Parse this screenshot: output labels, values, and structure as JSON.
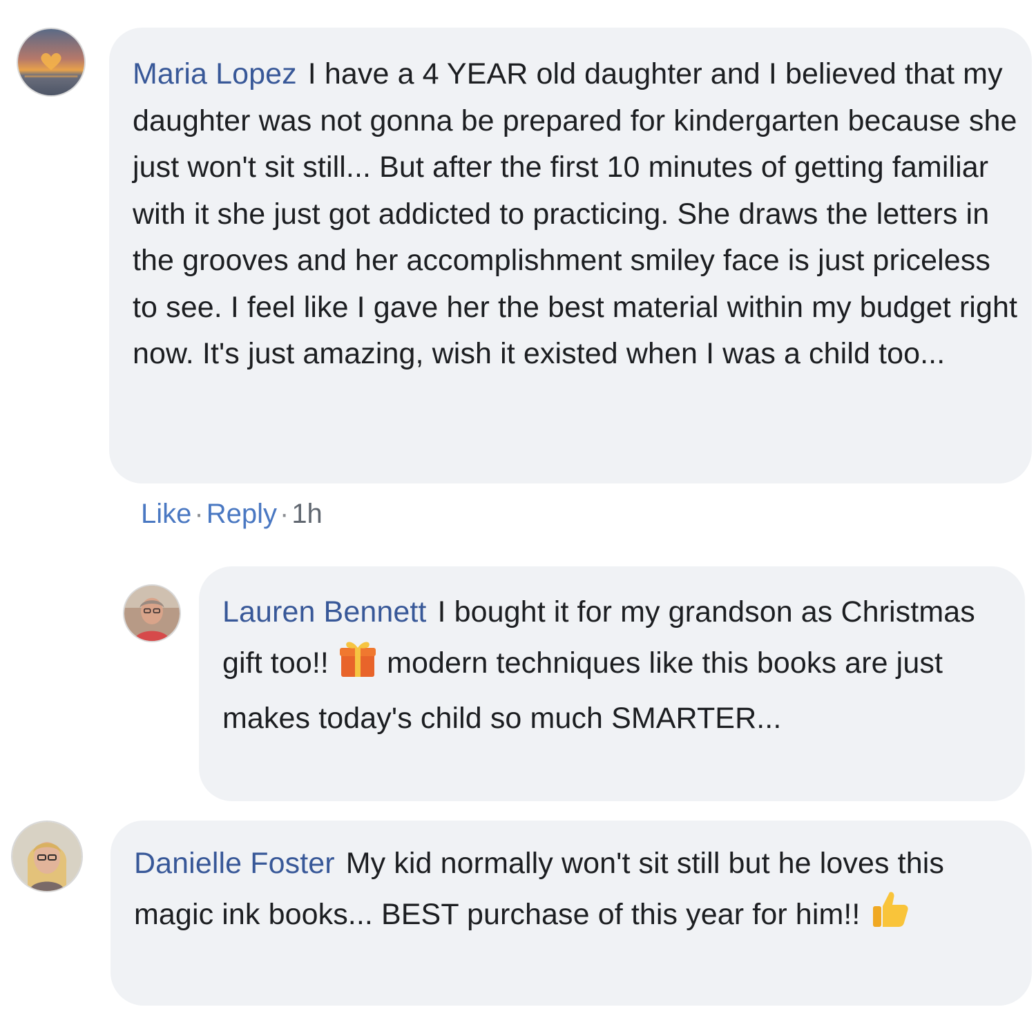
{
  "comments": [
    {
      "author": "Maria Lopez",
      "text": "I have a 4 YEAR old daughter and I believed that my daughter was not gonna be prepared for kindergarten because she just won't sit still... But after the first 10 minutes of getting familiar with it she just got addicted to practicing. She draws the letters in the grooves and her accomplishment smiley face is just priceless to see. I feel like I gave her the best material within my budget right now. It's just amazing, wish it existed when I was a child too...",
      "avatar_icon": "sunset-heart-avatar"
    },
    {
      "author": "Lauren Bennett",
      "text_before_emoji": "I bought it for my grandson as Christmas gift too!!",
      "emoji": "gift-icon",
      "text_after_emoji": "modern techniques like this books are just makes today's child so much SMARTER...",
      "avatar_icon": "woman-glasses-avatar"
    },
    {
      "author": "Danielle Foster",
      "text_before_emoji": "My kid normally won't sit still but he loves this magic ink books... BEST purchase of this year for him!!",
      "emoji": "thumbs-up-icon",
      "avatar_icon": "woman-blonde-avatar"
    }
  ],
  "actions": {
    "like": "Like",
    "separator": "·",
    "reply": "Reply",
    "time": "1h"
  },
  "colors": {
    "bubble_bg": "#f0f2f5",
    "author_name": "#385898",
    "action_link": "#4a78c2",
    "text": "#1c1e21"
  }
}
